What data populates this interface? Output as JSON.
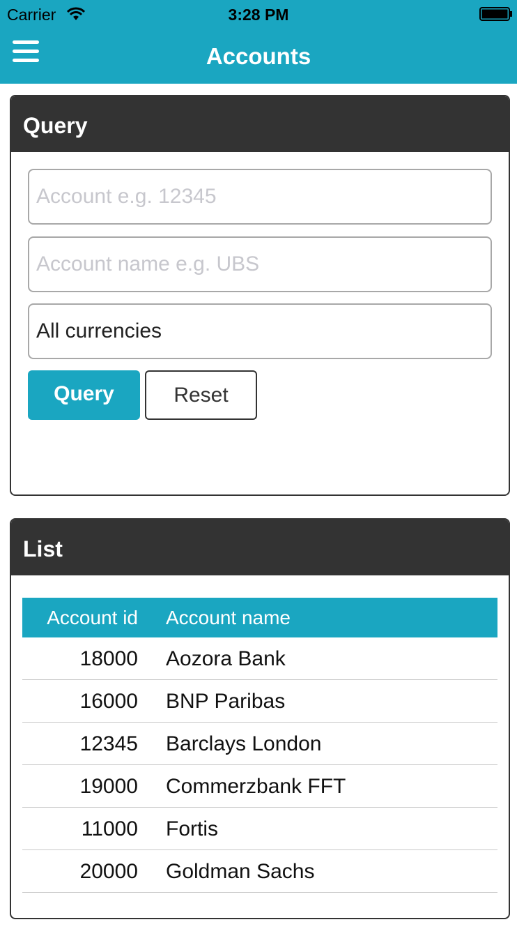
{
  "status_bar": {
    "carrier": "Carrier",
    "time": "3:28 PM"
  },
  "nav": {
    "title": "Accounts",
    "menu_icon": "hamburger-menu-icon"
  },
  "query_panel": {
    "title": "Query",
    "account_placeholder": "Account e.g. 12345",
    "account_value": "",
    "name_placeholder": "Account name e.g. UBS",
    "name_value": "",
    "currency_value": "All currencies",
    "query_label": "Query",
    "reset_label": "Reset"
  },
  "list_panel": {
    "title": "List",
    "columns": [
      "Account id",
      "Account name"
    ],
    "rows": [
      {
        "id": "18000",
        "name": "Aozora Bank"
      },
      {
        "id": "16000",
        "name": "BNP Paribas"
      },
      {
        "id": "12345",
        "name": "Barclays London"
      },
      {
        "id": "19000",
        "name": "Commerzbank FFT"
      },
      {
        "id": "11000",
        "name": "Fortis"
      },
      {
        "id": "20000",
        "name": "Goldman Sachs"
      }
    ]
  },
  "colors": {
    "accent": "#1aa6c1",
    "panel_header": "#333333"
  }
}
